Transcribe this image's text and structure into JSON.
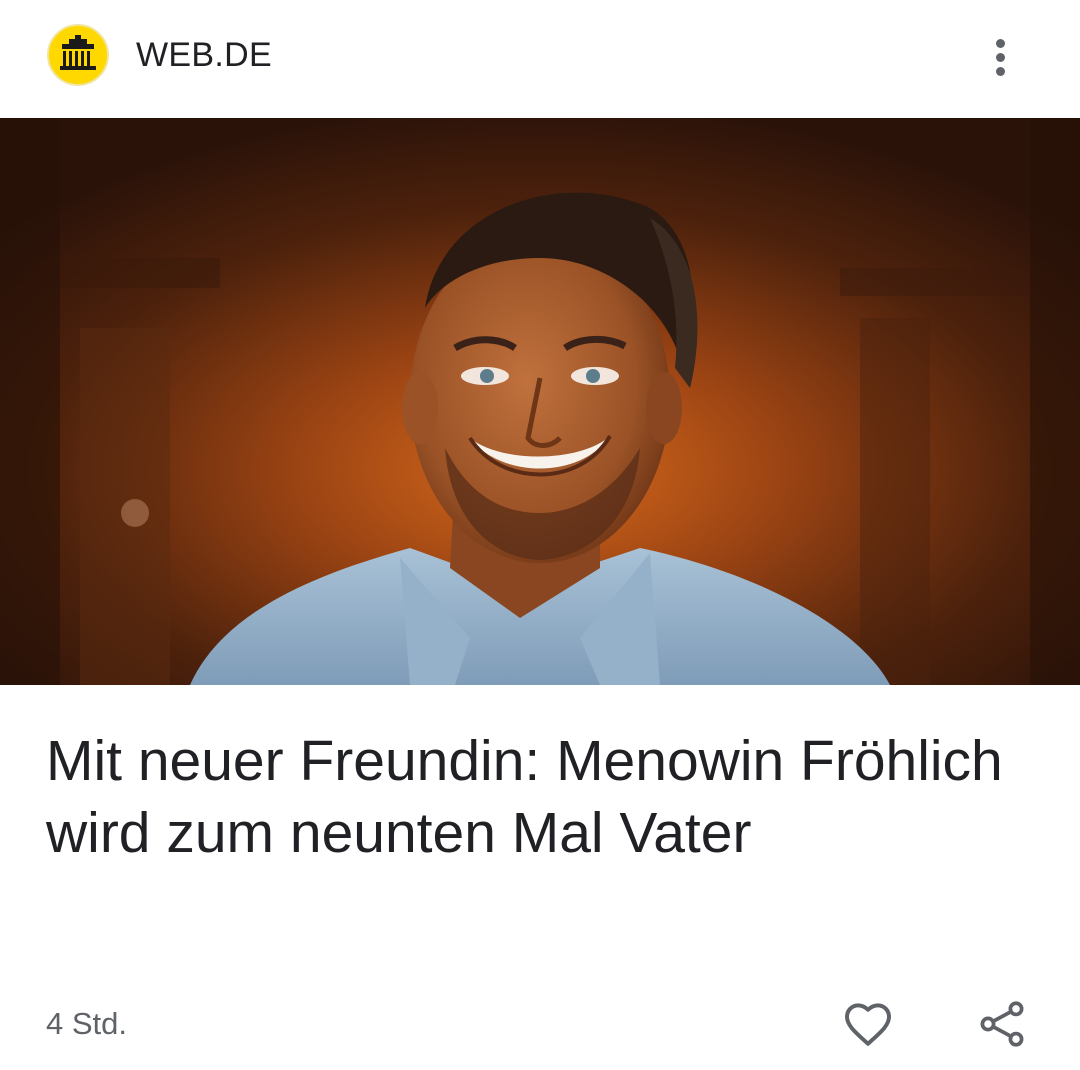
{
  "source": {
    "name": "WEB.DE",
    "logo_icon": "brandenburg-gate-icon",
    "logo_color": "#ffd800"
  },
  "header": {
    "more_icon": "more-vert-icon"
  },
  "article": {
    "image_alt_subject": "portrait-photo",
    "headline": "Mit neuer Freundin: Menowin Fröhlich wird zum neunten Mal Vater",
    "timestamp": "4 Std."
  },
  "actions": {
    "like_icon": "heart-outline-icon",
    "share_icon": "share-icon"
  },
  "colors": {
    "text_primary": "#202124",
    "text_secondary": "#5f6368",
    "icon": "#5f6368"
  }
}
